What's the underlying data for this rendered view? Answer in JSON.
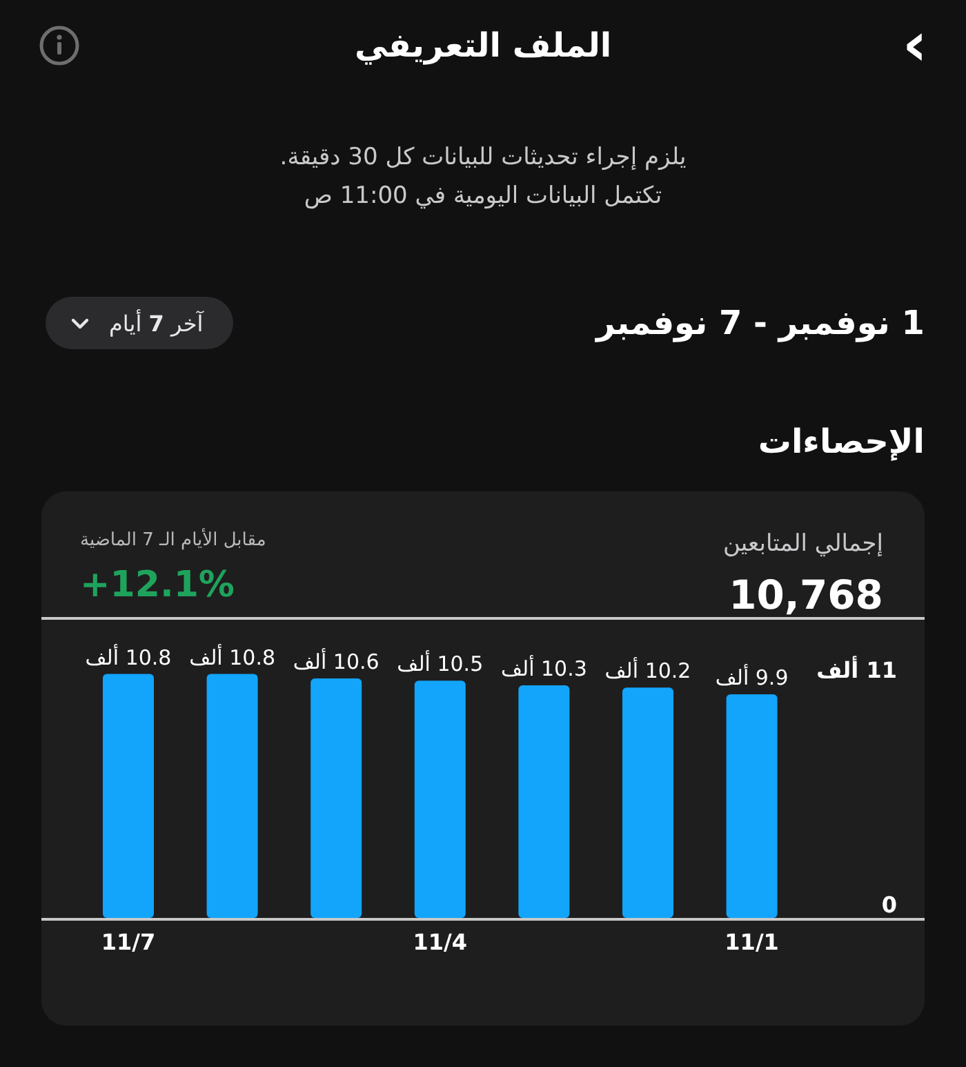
{
  "header": {
    "back_icon": "›",
    "title": "الملف التعريفي"
  },
  "notice": [
    "يلزم إجراء تحديثات للبيانات كل 30 دقيقة.",
    "تكتمل البيانات اليومية في 11:00 ص"
  ],
  "date_range": "1 نوفمبر - 7 نوفمبر",
  "period_button": "آخر **7** أيام",
  "section_title": "الإحصاءات",
  "stats": {
    "label": "إجمالي المتابعين",
    "value": "10,768",
    "comparison_label": "مقابل الأيام الـ 7 الماضية",
    "change": "+12.1%",
    "chart_data": {
      "type": "bar",
      "orientation": "vertical",
      "ylim": [
        0,
        11
      ],
      "yticks": [
        {
          "value": 0,
          "label": "0"
        },
        {
          "value": 11,
          "label": "11 ألف"
        }
      ],
      "categories": [
        "11/7",
        null,
        null,
        "11/4",
        null,
        null,
        "11/1"
      ],
      "series": [
        {
          "color": "#12a5fb",
          "values": [
            10.8,
            10.8,
            10.6,
            10.5,
            10.3,
            10.2,
            9.9
          ]
        }
      ],
      "value_labels": [
        "10.8 ألف",
        "10.8 ألف",
        "10.6 ألف",
        "10.5 ألف",
        "10.3 ألف",
        "10.2 ألف",
        "9.9 ألف"
      ]
    }
  }
}
